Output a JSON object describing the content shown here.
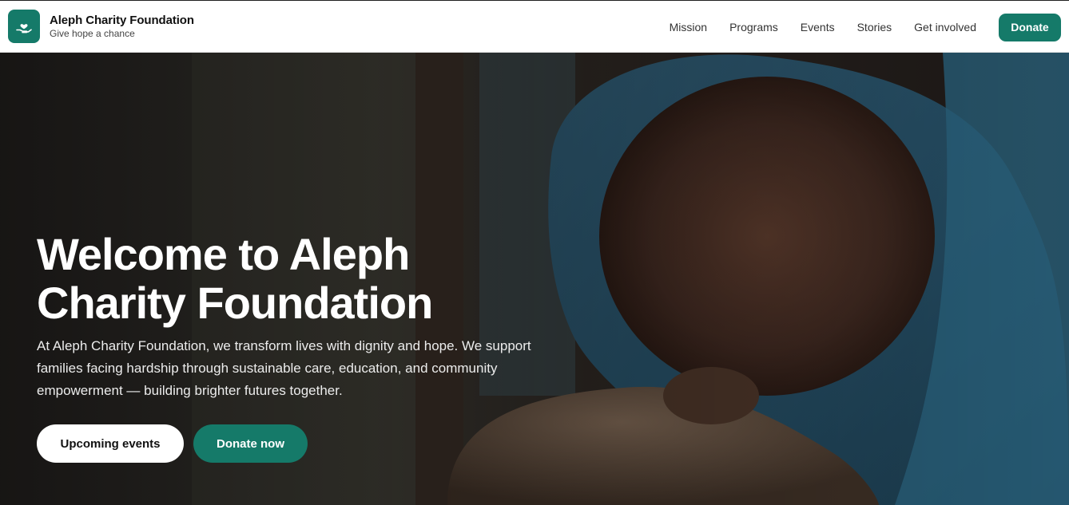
{
  "header": {
    "brand_name": "Aleph Charity Foundation",
    "brand_tagline": "Give hope a chance",
    "logo_icon": "hand-heart-icon",
    "nav": [
      {
        "label": "Mission"
      },
      {
        "label": "Programs"
      },
      {
        "label": "Events"
      },
      {
        "label": "Stories"
      },
      {
        "label": "Get involved"
      }
    ],
    "donate_label": "Donate"
  },
  "hero": {
    "title": "Welcome to Aleph Charity Foundation",
    "subtitle": "At Aleph Charity Foundation, we transform lives with dignity and hope. We support families facing hardship through sustainable care, education, and community empowerment — building brighter futures together.",
    "primary_button": "Upcoming events",
    "secondary_button": "Donate now"
  },
  "colors": {
    "brand_green": "#157a69",
    "header_bg": "#ffffff",
    "hero_text": "#ffffff"
  }
}
